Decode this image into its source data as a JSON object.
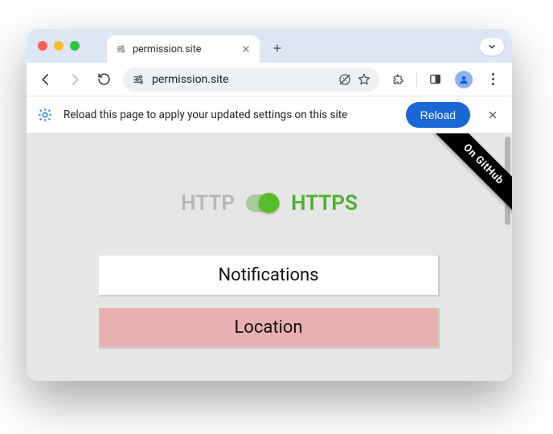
{
  "tab": {
    "title": "permission.site"
  },
  "omnibox": {
    "url_text": "permission.site"
  },
  "infobar": {
    "message": "Reload this page to apply your updated settings on this site",
    "button_label": "Reload"
  },
  "content": {
    "ribbon_label": "On GitHub",
    "protocol_left": "HTTP",
    "protocol_right": "HTTPS",
    "buttons": {
      "notifications": "Notifications",
      "location": "Location"
    }
  }
}
